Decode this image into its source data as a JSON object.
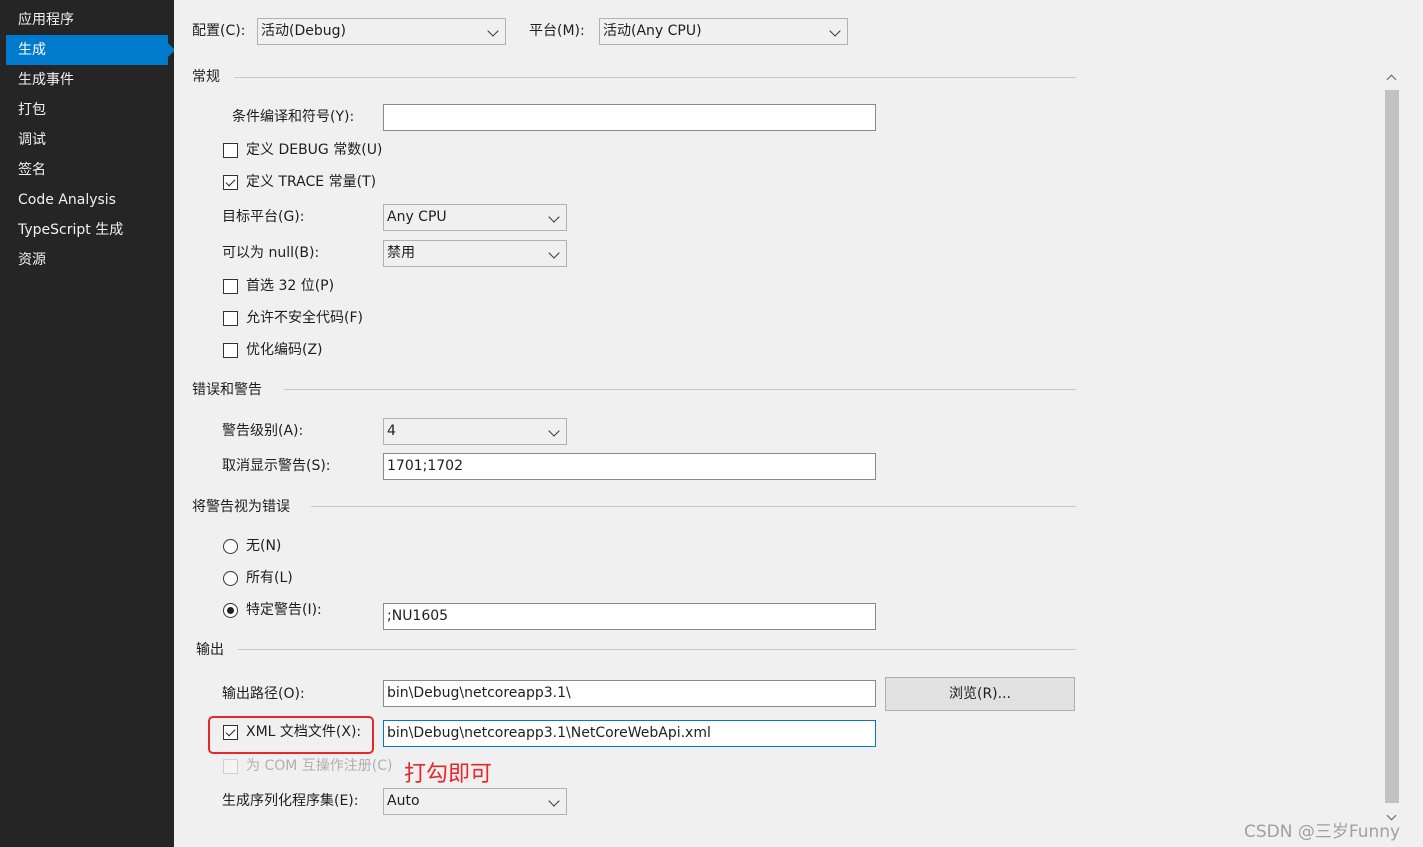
{
  "sidebar": {
    "items": [
      {
        "label": "应用程序"
      },
      {
        "label": "生成"
      },
      {
        "label": "生成事件"
      },
      {
        "label": "打包"
      },
      {
        "label": "调试"
      },
      {
        "label": "签名"
      },
      {
        "label": "Code Analysis"
      },
      {
        "label": "TypeScript 生成"
      },
      {
        "label": "资源"
      }
    ],
    "active_index": 1
  },
  "top": {
    "config_label": "配置(C):",
    "config_value": "活动(Debug)",
    "platform_label": "平台(M):",
    "platform_value": "活动(Any CPU)"
  },
  "general": {
    "title": "常规",
    "conditional_symbols_label": "条件编译和符号(Y):",
    "conditional_symbols_value": "",
    "define_debug_label": "定义 DEBUG 常数(U)",
    "define_debug_checked": false,
    "define_trace_label": "定义 TRACE 常量(T)",
    "define_trace_checked": true,
    "target_platform_label": "目标平台(G):",
    "target_platform_value": "Any CPU",
    "nullable_label": "可以为 null(B):",
    "nullable_value": "禁用",
    "prefer32_label": "首选 32 位(P)",
    "prefer32_checked": false,
    "unsafe_label": "允许不安全代码(F)",
    "unsafe_checked": false,
    "optimize_label": "优化编码(Z)",
    "optimize_checked": false
  },
  "errors": {
    "title": "错误和警告",
    "warning_level_label": "警告级别(A):",
    "warning_level_value": "4",
    "suppress_label": "取消显示警告(S):",
    "suppress_value": "1701;1702"
  },
  "treat_warnings": {
    "title": "将警告视为错误",
    "none_label": "无(N)",
    "all_label": "所有(L)",
    "specific_label": "特定警告(I):",
    "selected": "specific",
    "specific_value": ";NU1605"
  },
  "output": {
    "title": "输出",
    "path_label": "输出路径(O):",
    "path_value": "bin\\Debug\\netcoreapp3.1\\",
    "browse_label": "浏览(R)...",
    "xml_doc_label": "XML 文档文件(X):",
    "xml_doc_checked": true,
    "xml_doc_value": "bin\\Debug\\netcoreapp3.1\\NetCoreWebApi.xml",
    "com_register_label": "为 COM 互操作注册(C)",
    "com_register_checked": false,
    "serialization_label": "生成序列化程序集(E):",
    "serialization_value": "Auto"
  },
  "annotation": {
    "text": "打勾即可",
    "color": "#e8262c"
  },
  "watermark": "CSDN @三岁Funny",
  "colors": {
    "sidebar_bg": "#252526",
    "accent": "#007acc",
    "content_bg": "#f0f0f0"
  }
}
